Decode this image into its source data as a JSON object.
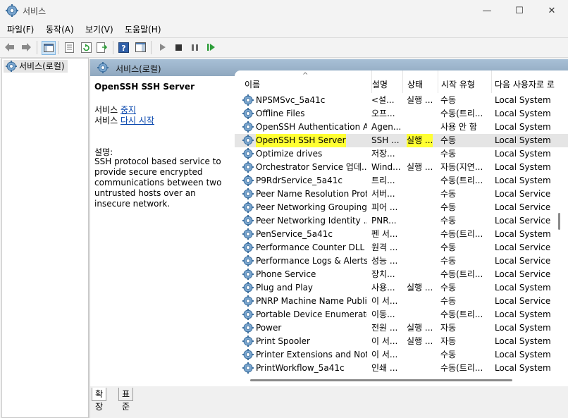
{
  "window": {
    "title": "서비스"
  },
  "menu": [
    "파일(F)",
    "동작(A)",
    "보기(V)",
    "도움말(H)"
  ],
  "tree": {
    "root_label": "서비스(로컬)"
  },
  "header": {
    "title": "서비스(로컬)"
  },
  "details": {
    "service_name": "OpenSSH SSH Server",
    "stop_prefix": "서비스 ",
    "stop_link": "중지",
    "restart_prefix": "서비스 ",
    "restart_link": "다시 시작",
    "desc_label": "설명:",
    "desc_text": "SSH protocol based service to provide secure encrypted communications between two untrusted hosts over an insecure network."
  },
  "columns": [
    "이름",
    "설명",
    "상태",
    "시작 유형",
    "다음 사용자로 로"
  ],
  "rows": [
    {
      "name": "NPSMSvc_5a41c",
      "desc": "<설...",
      "status": "실행 ...",
      "start": "수동",
      "logon": "Local System"
    },
    {
      "name": "Offline Files",
      "desc": "오프...",
      "status": "",
      "start": "수동(트리...",
      "logon": "Local System"
    },
    {
      "name": "OpenSSH Authentication A...",
      "desc": "Agen...",
      "status": "",
      "start": "사용 안 함",
      "logon": "Local System"
    },
    {
      "name": "OpenSSH SSH Server",
      "desc": "SSH ...",
      "status": "실행 ...",
      "start": "수동",
      "logon": "Local System",
      "selected": true
    },
    {
      "name": "Optimize drives",
      "desc": "저장...",
      "status": "",
      "start": "수동",
      "logon": "Local System"
    },
    {
      "name": "Orchestrator Service 업데...",
      "desc": "Wind...",
      "status": "실행 ...",
      "start": "자동(지연...",
      "logon": "Local System"
    },
    {
      "name": "P9RdrService_5a41c",
      "desc": "트리...",
      "status": "",
      "start": "수동(트리...",
      "logon": "Local System"
    },
    {
      "name": "Peer Name Resolution Prot...",
      "desc": "서버...",
      "status": "",
      "start": "수동",
      "logon": "Local Service"
    },
    {
      "name": "Peer Networking Grouping",
      "desc": "피어 ...",
      "status": "",
      "start": "수동",
      "logon": "Local Service"
    },
    {
      "name": "Peer Networking Identity ...",
      "desc": "PNR...",
      "status": "",
      "start": "수동",
      "logon": "Local Service"
    },
    {
      "name": "PenService_5a41c",
      "desc": "펜 서...",
      "status": "",
      "start": "수동(트리...",
      "logon": "Local System"
    },
    {
      "name": "Performance Counter DLL ...",
      "desc": "원격 ...",
      "status": "",
      "start": "수동",
      "logon": "Local Service"
    },
    {
      "name": "Performance Logs & Alerts",
      "desc": "성능 ...",
      "status": "",
      "start": "수동",
      "logon": "Local Service"
    },
    {
      "name": "Phone Service",
      "desc": "장치...",
      "status": "",
      "start": "수동(트리...",
      "logon": "Local Service"
    },
    {
      "name": "Plug and Play",
      "desc": "사용...",
      "status": "실행 ...",
      "start": "수동",
      "logon": "Local System"
    },
    {
      "name": "PNRP Machine Name Publi...",
      "desc": "이 서...",
      "status": "",
      "start": "수동",
      "logon": "Local Service"
    },
    {
      "name": "Portable Device Enumerato...",
      "desc": "이동...",
      "status": "",
      "start": "수동(트리...",
      "logon": "Local System"
    },
    {
      "name": "Power",
      "desc": "전원 ...",
      "status": "실행 ...",
      "start": "자동",
      "logon": "Local System"
    },
    {
      "name": "Print Spooler",
      "desc": "이 서...",
      "status": "실행 ...",
      "start": "자동",
      "logon": "Local System"
    },
    {
      "name": "Printer Extensions and Noti...",
      "desc": "이 서...",
      "status": "",
      "start": "수동",
      "logon": "Local System"
    },
    {
      "name": "PrintWorkflow_5a41c",
      "desc": "인쇄 ...",
      "status": "",
      "start": "수동(트리...",
      "logon": "Local System"
    }
  ],
  "tabs": [
    "확장",
    "표준"
  ],
  "icons": {
    "app": "services-gear-icon",
    "row": "service-gear-icon"
  }
}
